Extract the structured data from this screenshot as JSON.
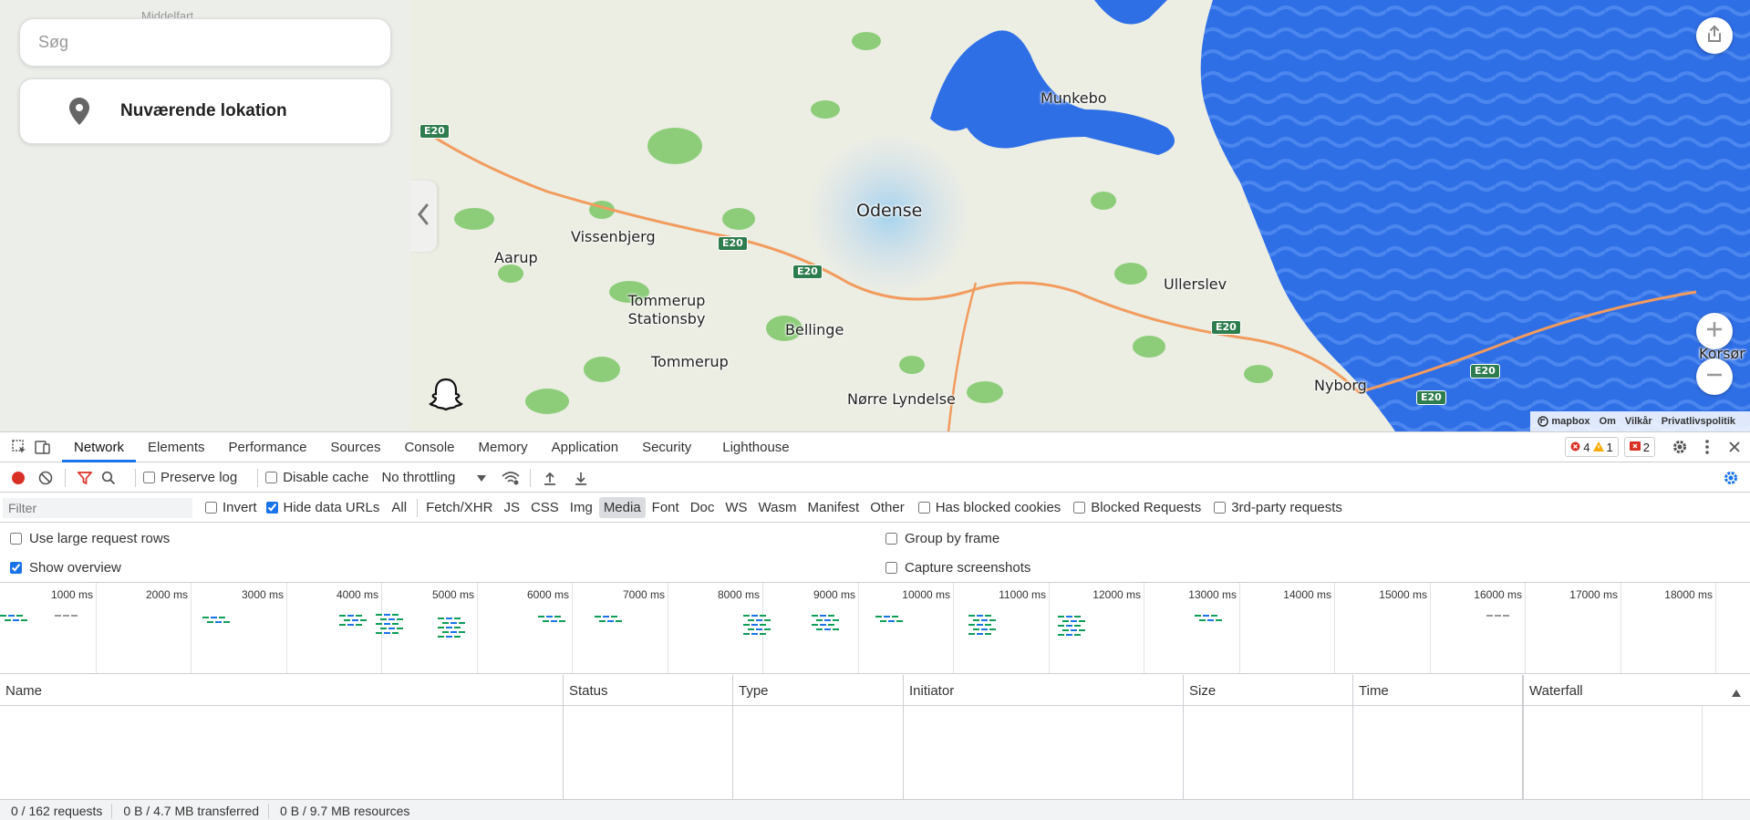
{
  "map": {
    "search_placeholder": "Søg",
    "current_location_label": "Nuværende lokation",
    "top_label_partial": "Middelfart",
    "cities": [
      {
        "name": "Munkebo",
        "cls": ""
      },
      {
        "name": "Odense",
        "cls": "big"
      },
      {
        "name": "Vissenbjerg",
        "cls": ""
      },
      {
        "name": "Aarup",
        "cls": ""
      },
      {
        "name": "Tommerup\nStationsby",
        "cls": ""
      },
      {
        "name": "Bellinge",
        "cls": ""
      },
      {
        "name": "Tommerup",
        "cls": ""
      },
      {
        "name": "Ullerslev",
        "cls": ""
      },
      {
        "name": "Nyborg",
        "cls": ""
      },
      {
        "name": "Nørre Lyndelse",
        "cls": ""
      },
      {
        "name": "Korsør",
        "cls": ""
      }
    ],
    "road_label": "E20",
    "attribution": {
      "brand": "mapbox",
      "about": "Om",
      "terms": "Vilkår",
      "privacy": "Privatlivspolitik"
    },
    "icons": {
      "pin": "location-pin-icon",
      "collapse": "chevron-left-icon",
      "ghost": "snapchat-ghost-icon",
      "share": "share-icon",
      "zoom_in": "plus-icon",
      "zoom_out": "minus-icon"
    }
  },
  "devtools": {
    "tabs": [
      "Network",
      "Elements",
      "Performance",
      "Sources",
      "Console",
      "Memory",
      "Application",
      "Security",
      "Lighthouse"
    ],
    "active_tab": "Network",
    "errors": "4",
    "warnings": "1",
    "issues": "2",
    "toolbar": {
      "preserve_log": "Preserve log",
      "disable_cache": "Disable cache",
      "throttling": "No throttling"
    },
    "filter": {
      "placeholder": "Filter",
      "invert": "Invert",
      "hide_data_urls": "Hide data URLs",
      "types": [
        "All",
        "Fetch/XHR",
        "JS",
        "CSS",
        "Img",
        "Media",
        "Font",
        "Doc",
        "WS",
        "Wasm",
        "Manifest",
        "Other"
      ],
      "active_type": "Media",
      "has_blocked_cookies": "Has blocked cookies",
      "blocked_requests": "Blocked Requests",
      "third_party": "3rd-party requests"
    },
    "options": {
      "large_rows": "Use large request rows",
      "show_overview": "Show overview",
      "group_by_frame": "Group by frame",
      "capture_screenshots": "Capture screenshots"
    },
    "overview_ticks": [
      "1000 ms",
      "2000 ms",
      "3000 ms",
      "4000 ms",
      "5000 ms",
      "6000 ms",
      "7000 ms",
      "8000 ms",
      "9000 ms",
      "10000 ms",
      "11000 ms",
      "12000 ms",
      "13000 ms",
      "14000 ms",
      "15000 ms",
      "16000 ms",
      "17000 ms",
      "18000 ms"
    ],
    "columns": [
      "Name",
      "Status",
      "Type",
      "Initiator",
      "Size",
      "Time",
      "Waterfall"
    ],
    "status": {
      "requests": "0 / 162 requests",
      "transferred": "0 B / 4.7 MB transferred",
      "resources": "0 B / 9.7 MB resources"
    },
    "colors": {
      "accent": "#1a73e8",
      "record": "#d93025",
      "filter_active": "#d93025"
    }
  }
}
